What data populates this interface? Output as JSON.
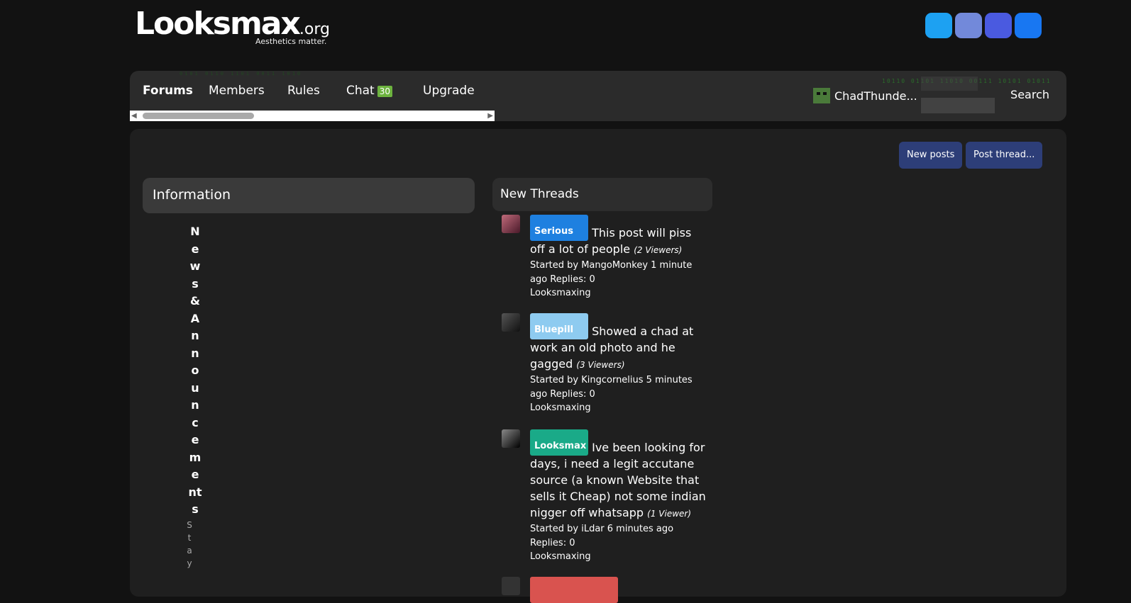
{
  "header": {
    "logo_main": "Looksmax",
    "logo_tld": ".org",
    "tagline": "Aesthetics matter."
  },
  "social_colors": [
    "#1da1f2",
    "#7289da",
    "#4a5ae0",
    "#1877f2"
  ],
  "nav": {
    "tabs": [
      {
        "label": "Forums",
        "active": true
      },
      {
        "label": "Members"
      },
      {
        "label": "Rules"
      },
      {
        "label": "Chat",
        "badge": "30"
      },
      {
        "label": "Upgrade"
      }
    ],
    "user": "ChadThunde...",
    "search": "Search"
  },
  "actions": {
    "new_posts": "New posts",
    "post_thread": "Post thread..."
  },
  "info": {
    "title": "Information",
    "node_title": "News&Announcements",
    "node_desc": "Stay"
  },
  "threads": {
    "title": "New Threads",
    "items": [
      {
        "prefix": "Serious",
        "prefix_color": "#1e80e0",
        "title": "This post will piss off a lot of people",
        "viewers": "(2 Viewers)",
        "started": "Started by MangoMonkey 1 minute ago Replies: 0",
        "forum": "Looksmaxing"
      },
      {
        "prefix": "Bluepill",
        "prefix_color": "#8ecbf0",
        "title": "Showed a chad at work an old photo and he gagged",
        "viewers": "(3 Viewers)",
        "started": "Started by Kingcornelius 5 minutes ago Replies: 0",
        "forum": "Looksmaxing"
      },
      {
        "prefix": "Looksmax",
        "prefix_color": "#1aaa88",
        "title": "Ive been looking for days, i need a legit accutane source (a known Website that sells it Cheap) not some indian nigger off whatsapp",
        "viewers": "(1 Viewer)",
        "started": "Started by iLdar 6 minutes ago Replies: 0",
        "forum": "Looksmaxing"
      }
    ]
  }
}
